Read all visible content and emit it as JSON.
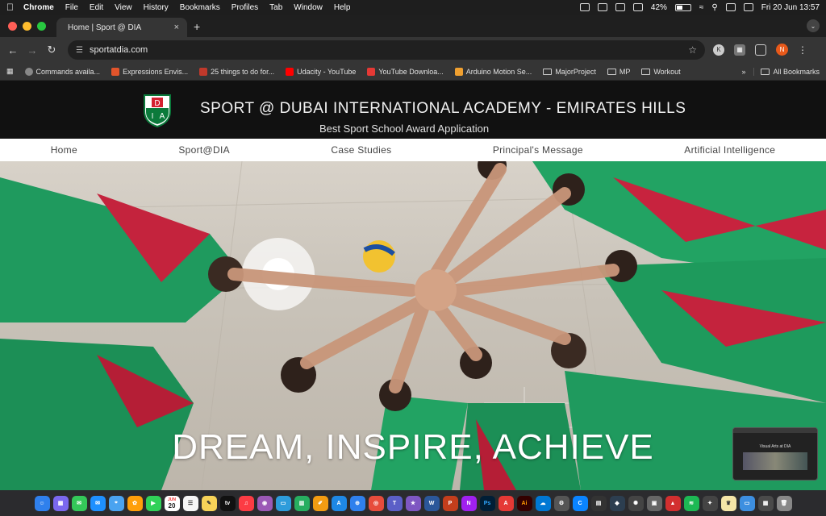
{
  "menubar": {
    "app": "Chrome",
    "items": [
      "File",
      "Edit",
      "View",
      "History",
      "Bookmarks",
      "Profiles",
      "Tab",
      "Window",
      "Help"
    ],
    "battery": "42%",
    "battery_level": 0.42,
    "datetime": "Fri 20 Jun  13:57"
  },
  "tab": {
    "title": "Home | Sport @ DIA",
    "close": "×",
    "new": "+"
  },
  "toolbar": {
    "url": "sportatdia.com",
    "profile_initial": "N"
  },
  "bookmarks": {
    "items": [
      {
        "label": "Commands availa...",
        "color": "#888888"
      },
      {
        "label": "Expressions Envis...",
        "color": "#e2542b"
      },
      {
        "label": "25 things to do for...",
        "color": "#c0392b"
      },
      {
        "label": "Udacity - YouTube",
        "color": "#ff0000"
      },
      {
        "label": "YouTube Downloa...",
        "color": "#e53935"
      },
      {
        "label": "Arduino Motion Se...",
        "color": "#f0a030"
      }
    ],
    "folders": [
      "MajorProject",
      "MP",
      "Workout"
    ],
    "more": "»",
    "all": "All Bookmarks"
  },
  "site": {
    "crest_top": "D",
    "crest_left": "I",
    "crest_right": "A",
    "title": "SPORT @ DUBAI INTERNATIONAL ACADEMY - EMIRATES HILLS",
    "subtitle": "Best Sport School Award Application",
    "nav": [
      "Home",
      "Sport@DIA",
      "Case Studies",
      "Principal's Message",
      "Artificial Intelligence"
    ],
    "hero_text": "DREAM, INSPIRE, ACHIEVE"
  },
  "thumbnail": {
    "caption": "Visual Arts at DIA"
  },
  "dock": {
    "calendar_day": "20",
    "calendar_month": "JUN"
  }
}
